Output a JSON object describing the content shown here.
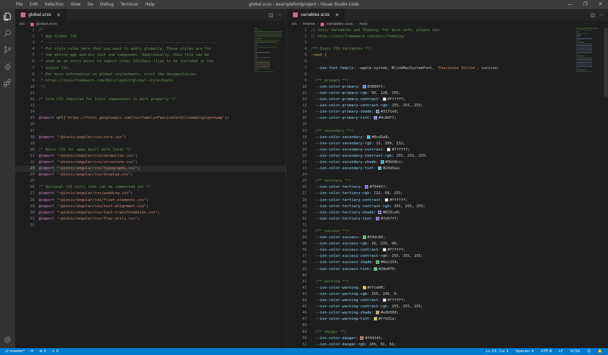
{
  "window": {
    "title": "global.scss - examplefontproject - Visual Studio Code",
    "menu": [
      "File",
      "Edit",
      "Selection",
      "View",
      "Go",
      "Debug",
      "Terminal",
      "Help"
    ],
    "controls": [
      "—",
      "❐",
      "✕"
    ]
  },
  "activitybar": [
    "explorer-icon",
    "search-icon",
    "source-control-icon",
    "debug-icon",
    "extensions-icon",
    "settings-gear-icon"
  ],
  "left_editor": {
    "tab": "global.scss",
    "breadcrumb": [
      "src",
      "global.scss"
    ],
    "current_line": 23,
    "lines": [
      {
        "n": 1,
        "t": "/*",
        "c": "cmt"
      },
      {
        "n": 2,
        "t": " * App Global CSS",
        "c": "cmt"
      },
      {
        "n": 3,
        "t": " * ----------------------------------------------------------------------------",
        "c": "cmt"
      },
      {
        "n": 4,
        "t": " * Put style rules here that you want to apply globally. These styles are for",
        "c": "cmt"
      },
      {
        "n": 5,
        "t": " * the entire app and not just one component. Additionally, this file can be",
        "c": "cmt"
      },
      {
        "n": 6,
        "t": " * used as an entry point to import other CSS/Sass files to be included in the",
        "c": "cmt"
      },
      {
        "n": 7,
        "t": " * output CSS.",
        "c": "cmt"
      },
      {
        "n": 8,
        "t": " * For more information on global stylesheets, visit the documentation:",
        "c": "cmt"
      },
      {
        "n": 9,
        "t": " * https://ionicframework.com/docs/layout/global-stylesheets",
        "c": "cmt"
      },
      {
        "n": 10,
        "t": " */",
        "c": "cmt"
      },
      {
        "n": 11,
        "t": "",
        "c": ""
      },
      {
        "n": 12,
        "t": "/* Core CSS required for Ionic components to work properly */",
        "c": "cmt"
      },
      {
        "n": 13,
        "t": "",
        "c": ""
      },
      {
        "n": 14,
        "t": "",
        "c": ""
      },
      {
        "n": 15,
        "a": "@import",
        "b": " url(",
        "s": "'https://fonts.googleapis.com/css?family=Fascinate+Inline&display=swap'",
        "e": ");"
      },
      {
        "n": 16,
        "t": "",
        "c": ""
      },
      {
        "n": 17,
        "t": "",
        "c": ""
      },
      {
        "n": 18,
        "a": "@import",
        "b": " ",
        "s": "\"~@ionic/angular/css/core.css\"",
        "e": ";"
      },
      {
        "n": 19,
        "t": "",
        "c": ""
      },
      {
        "n": 20,
        "t": "/* Basic CSS for apps built with Ionic */",
        "c": "cmt"
      },
      {
        "n": 21,
        "a": "@import",
        "b": " ",
        "s": "\"~@ionic/angular/css/normalize.css\"",
        "e": ";"
      },
      {
        "n": 22,
        "a": "@import",
        "b": " ",
        "s": "\"~@ionic/angular/css/structure.css\"",
        "e": ";"
      },
      {
        "n": 23,
        "a": "@import",
        "b": " ",
        "s": "\"~@ionic/angular/css/typography.css\"",
        "e": ";"
      },
      {
        "n": 24,
        "a": "@import",
        "b": " ",
        "s": "\"~@ionic/angular/css/display.css\"",
        "e": ";"
      },
      {
        "n": 25,
        "t": "",
        "c": ""
      },
      {
        "n": 26,
        "t": "/* Optional CSS utils that can be commented out */",
        "c": "cmt"
      },
      {
        "n": 27,
        "a": "@import",
        "b": " ",
        "s": "\"~@ionic/angular/css/padding.css\"",
        "e": ";"
      },
      {
        "n": 28,
        "a": "@import",
        "b": " ",
        "s": "\"~@ionic/angular/css/float-elements.css\"",
        "e": ";"
      },
      {
        "n": 29,
        "a": "@import",
        "b": " ",
        "s": "\"~@ionic/angular/css/text-alignment.css\"",
        "e": ";"
      },
      {
        "n": 30,
        "a": "@import",
        "b": " ",
        "s": "\"~@ionic/angular/css/text-transformation.css\"",
        "e": ";"
      },
      {
        "n": 31,
        "a": "@import",
        "b": " ",
        "s": "\"~@ionic/angular/css/flex-utils.css\"",
        "e": ";"
      },
      {
        "n": 32,
        "t": "",
        "c": ""
      }
    ]
  },
  "right_editor": {
    "tab": "variables.scss",
    "breadcrumb": [
      "src",
      "theme",
      "variables.scss",
      ":root"
    ],
    "lines": [
      {
        "n": 1,
        "t": "// Ionic Variables and Theming. For more info, please see:",
        "c": "cmt"
      },
      {
        "n": 2,
        "t": "// http://ionicframework.com/docs/theming/",
        "c": "cmt"
      },
      {
        "n": 3,
        "t": "",
        "c": ""
      },
      {
        "n": 4,
        "t": "/** Ionic CSS Variables **/",
        "c": "cmt"
      },
      {
        "n": 5,
        "t": ":root {",
        "c": "sel"
      },
      {
        "n": 6,
        "t": "",
        "c": ""
      },
      {
        "n": 7,
        "p": "  --ion-font-family",
        "v": ": -apple-system, BlinkMacSystemFont, ",
        "s": "'Fascinate Inline'",
        "e": ", cursive;"
      },
      {
        "n": 8,
        "t": "",
        "c": ""
      },
      {
        "n": 9,
        "t": "  /** primary **/",
        "c": "cmt"
      },
      {
        "n": 10,
        "p": "  --ion-color-primary",
        "v": ": ",
        "sw": "#3880ff",
        "e": "#3880ff;"
      },
      {
        "n": 11,
        "p": "  --ion-color-primary-rgb",
        "v": ": 56, 128, 255;"
      },
      {
        "n": 12,
        "p": "  --ion-color-primary-contrast",
        "v": ": ",
        "sw": "#ffffff",
        "e": "#ffffff;"
      },
      {
        "n": 13,
        "p": "  --ion-color-primary-contrast-rgb",
        "v": ": 255, 255, 255;"
      },
      {
        "n": 14,
        "p": "  --ion-color-primary-shade",
        "v": ": ",
        "sw": "#3171e0",
        "e": "#3171e0;"
      },
      {
        "n": 15,
        "p": "  --ion-color-primary-tint",
        "v": ": ",
        "sw": "#4c8dff",
        "e": "#4c8dff;"
      },
      {
        "n": 16,
        "t": "",
        "c": ""
      },
      {
        "n": 17,
        "t": "  /** secondary **/",
        "c": "cmt"
      },
      {
        "n": 18,
        "p": "  --ion-color-secondary",
        "v": ": ",
        "sw": "#0cd1e8",
        "e": "#0cd1e8;"
      },
      {
        "n": 19,
        "p": "  --ion-color-secondary-rgb",
        "v": ": 12, 209, 232;"
      },
      {
        "n": 20,
        "p": "  --ion-color-secondary-contrast",
        "v": ": ",
        "sw": "#ffffff",
        "e": "#ffffff;"
      },
      {
        "n": 21,
        "p": "  --ion-color-secondary-contrast-rgb",
        "v": ": 255, 255, 255;"
      },
      {
        "n": 22,
        "p": "  --ion-color-secondary-shade",
        "v": ": ",
        "sw": "#0bb8cc",
        "e": "#0bb8cc;"
      },
      {
        "n": 23,
        "p": "  --ion-color-secondary-tint",
        "v": ": ",
        "sw": "#24d6ea",
        "e": "#24d6ea;"
      },
      {
        "n": 24,
        "t": "",
        "c": ""
      },
      {
        "n": 25,
        "t": "  /** tertiary **/",
        "c": "cmt"
      },
      {
        "n": 26,
        "p": "  --ion-color-tertiary",
        "v": ": ",
        "sw": "#7044ff",
        "e": "#7044ff;"
      },
      {
        "n": 27,
        "p": "  --ion-color-tertiary-rgb",
        "v": ": 112, 68, 255;"
      },
      {
        "n": 28,
        "p": "  --ion-color-tertiary-contrast",
        "v": ": ",
        "sw": "#ffffff",
        "e": "#ffffff;"
      },
      {
        "n": 29,
        "p": "  --ion-color-tertiary-contrast-rgb",
        "v": ": 255, 255, 255;"
      },
      {
        "n": 30,
        "p": "  --ion-color-tertiary-shade",
        "v": ": ",
        "sw": "#633ce0",
        "e": "#633ce0;"
      },
      {
        "n": 31,
        "p": "  --ion-color-tertiary-tint",
        "v": ": ",
        "sw": "#7e57ff",
        "e": "#7e57ff;"
      },
      {
        "n": 32,
        "t": "",
        "c": ""
      },
      {
        "n": 33,
        "t": "  /** success **/",
        "c": "cmt"
      },
      {
        "n": 34,
        "p": "  --ion-color-success",
        "v": ": ",
        "sw": "#10dc60",
        "e": "#10dc60;"
      },
      {
        "n": 35,
        "p": "  --ion-color-success-rgb",
        "v": ": 16, 220, 96;"
      },
      {
        "n": 36,
        "p": "  --ion-color-success-contrast",
        "v": ": ",
        "sw": "#ffffff",
        "e": "#ffffff;"
      },
      {
        "n": 37,
        "p": "  --ion-color-success-contrast-rgb",
        "v": ": 255, 255, 255;"
      },
      {
        "n": 38,
        "p": "  --ion-color-success-shade",
        "v": ": ",
        "sw": "#0ec254",
        "e": "#0ec254;"
      },
      {
        "n": 39,
        "p": "  --ion-color-success-tint",
        "v": ": ",
        "sw": "#28e070",
        "e": "#28e070;"
      },
      {
        "n": 40,
        "t": "",
        "c": ""
      },
      {
        "n": 41,
        "t": "  /** warning **/",
        "c": "cmt"
      },
      {
        "n": 42,
        "p": "  --ion-color-warning",
        "v": ": ",
        "sw": "#ffce00",
        "e": "#ffce00;"
      },
      {
        "n": 43,
        "p": "  --ion-color-warning-rgb",
        "v": ": 255, 206, 0;"
      },
      {
        "n": 44,
        "p": "  --ion-color-warning-contrast",
        "v": ": ",
        "sw": "#ffffff",
        "e": "#ffffff;"
      },
      {
        "n": 45,
        "p": "  --ion-color-warning-contrast-rgb",
        "v": ": 255, 255, 255;"
      },
      {
        "n": 46,
        "p": "  --ion-color-warning-shade",
        "v": ": ",
        "sw": "#e0b500",
        "e": "#e0b500;"
      },
      {
        "n": 47,
        "p": "  --ion-color-warning-tint",
        "v": ": ",
        "sw": "#ffd31a",
        "e": "#ffd31a;"
      },
      {
        "n": 48,
        "t": "",
        "c": ""
      },
      {
        "n": 49,
        "t": "  /** danger **/",
        "c": "cmt"
      },
      {
        "n": 50,
        "p": "  --ion-color-danger",
        "v": ": ",
        "sw": "#f04141",
        "e": "#f04141;"
      },
      {
        "n": 51,
        "p": "  --ion-color-danger-rgb",
        "v": ": 245, 61, 61;"
      }
    ]
  },
  "statusbar": {
    "branch": "master*",
    "sync": "⟳",
    "errors": "⊗ 0",
    "warnings": "⚠ 0",
    "position": "Ln 23, Col 1",
    "spaces": "Spaces: 4",
    "encoding": "UTF-8",
    "eol": "LF",
    "language": "SCSS",
    "feedback": "☺",
    "bell": "🔔"
  },
  "colors": {
    "statusbar": "#007acc",
    "editor_bg": "#1e1e1e",
    "titlebar": "#3c3c3c"
  }
}
